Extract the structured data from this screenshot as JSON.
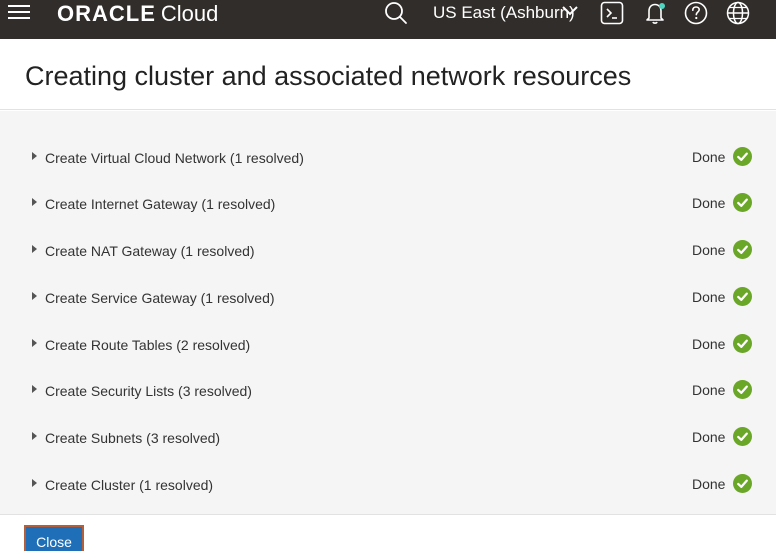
{
  "topbar": {
    "brand_oracle": "ORACLE",
    "brand_cloud": "Cloud",
    "region": "US East (Ashburn)",
    "icons": [
      "hamburger-menu-icon",
      "search-icon",
      "chevron-down-icon",
      "cloud-shell-icon",
      "notifications-bell-icon",
      "help-icon",
      "globe-icon"
    ]
  },
  "page": {
    "title": "Creating cluster and associated network resources"
  },
  "tasks": [
    {
      "label": "Create Virtual Cloud Network (1 resolved)",
      "status": "Done"
    },
    {
      "label": "Create Internet Gateway (1 resolved)",
      "status": "Done"
    },
    {
      "label": "Create NAT Gateway (1 resolved)",
      "status": "Done"
    },
    {
      "label": "Create Service Gateway (1 resolved)",
      "status": "Done"
    },
    {
      "label": "Create Route Tables (2 resolved)",
      "status": "Done"
    },
    {
      "label": "Create Security Lists (3 resolved)",
      "status": "Done"
    },
    {
      "label": "Create Subnets (3 resolved)",
      "status": "Done"
    },
    {
      "label": "Create Cluster (1 resolved)",
      "status": "Done"
    }
  ],
  "footer": {
    "close_label": "Close"
  },
  "colors": {
    "topbar": "#312d2a",
    "done_check": "#6aa627",
    "primary_button": "#1e6fb8",
    "notification_dot": "#4ed6c1"
  }
}
